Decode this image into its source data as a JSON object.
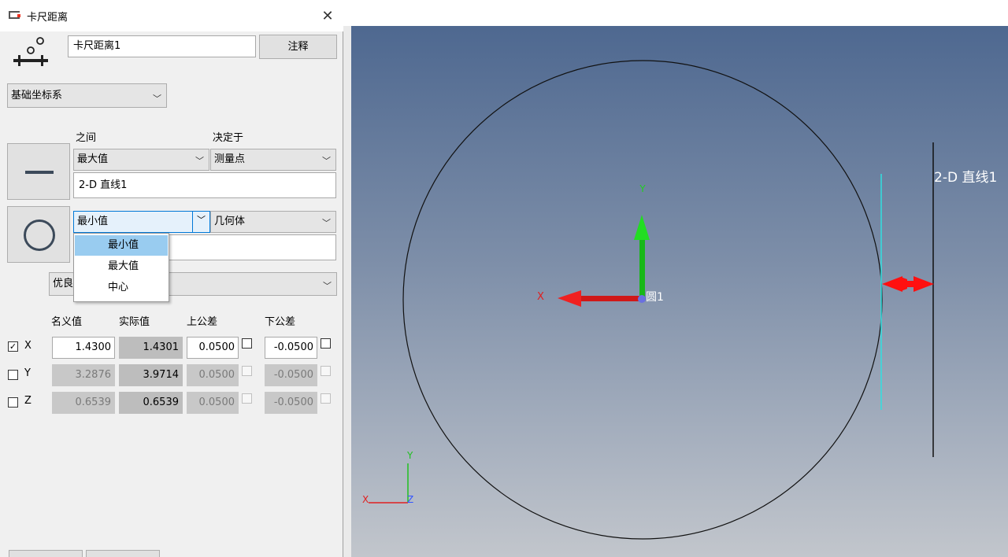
{
  "dialog": {
    "title": "卡尺距离",
    "name_value": "卡尺距离1",
    "annotation_button": "注释",
    "coord_system": "基础坐标系",
    "headers": {
      "between": "之间",
      "determined_by": "决定于"
    },
    "feature1": {
      "between_value": "最大值",
      "determined_value": "测量点",
      "feature_name": "2-D 直线1"
    },
    "feature2": {
      "between_value": "最小值",
      "determined_value": "几何体",
      "feature_name": ""
    },
    "dropdown_options": [
      "最小值",
      "最大值",
      "中心"
    ],
    "selected_option": "最小值",
    "quality_value": "优良",
    "table_headers": {
      "nominal": "名义值",
      "actual": "实际值",
      "upper_tol": "上公差",
      "lower_tol": "下公差"
    },
    "rows": [
      {
        "axis": "X",
        "checked": true,
        "nominal": "1.4300",
        "actual": "1.4301",
        "upper": "0.0500",
        "lower": "-0.0500"
      },
      {
        "axis": "Y",
        "checked": false,
        "nominal": "3.2876",
        "actual": "3.9714",
        "upper": "0.0500",
        "lower": "-0.0500"
      },
      {
        "axis": "Z",
        "checked": false,
        "nominal": "0.6539",
        "actual": "0.6539",
        "upper": "0.0500",
        "lower": "-0.0500"
      }
    ]
  },
  "viewport": {
    "line_label": "2-D 直线1",
    "circle_label": "圆1",
    "axis_x": "X",
    "axis_y": "Y",
    "triad_x": "X",
    "triad_y": "Y",
    "triad_z": "Z"
  },
  "colors": {
    "axis_red": "#e02020",
    "axis_green": "#20c020",
    "cyan": "#30e0e0",
    "selection": "#99ccf0"
  },
  "checkmark": "☑"
}
